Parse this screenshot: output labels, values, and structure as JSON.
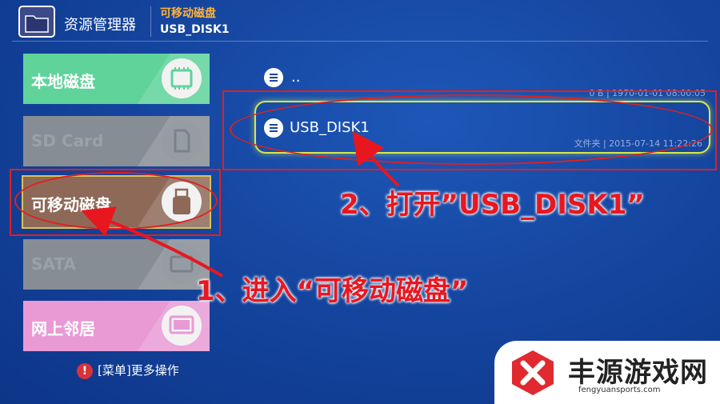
{
  "header": {
    "app_title": "资源管理器",
    "location_title": "可移动磁盘",
    "location_path": "USB_DISK1"
  },
  "sidebar": {
    "items": [
      {
        "label": "本地磁盘",
        "icon": "chip-icon",
        "color": "#5fd39a",
        "state": "enabled"
      },
      {
        "label": "SD Card",
        "icon": "sd-card-icon",
        "color": "#868d94",
        "state": "disabled"
      },
      {
        "label": "可移动磁盘",
        "icon": "usb-drive-icon",
        "color": "#8e6957",
        "state": "selected"
      },
      {
        "label": "SATA",
        "icon": "hdd-icon",
        "color": "#868d94",
        "state": "disabled"
      },
      {
        "label": "网上邻居",
        "icon": "network-screen-icon",
        "color": "#e99ad5",
        "state": "enabled"
      }
    ]
  },
  "menu_hint": "[菜单]更多操作",
  "files": [
    {
      "name": "..",
      "meta": "0 B | 1970-01-01 08:00:05"
    },
    {
      "name": "USB_DISK1",
      "meta": "文件夹 | 2015-07-14 11:22:26"
    }
  ],
  "annotations": {
    "step1": "1、进入“可移动磁盘”",
    "step2": "2、打开”USB_DISK1”"
  },
  "watermark": {
    "brand": "丰源游戏网",
    "site": "fengyuansports.com"
  },
  "colors": {
    "accent_orange": "#ffb23a",
    "annotation_red": "#e02020",
    "focus_yellow": "#d5e84a"
  }
}
